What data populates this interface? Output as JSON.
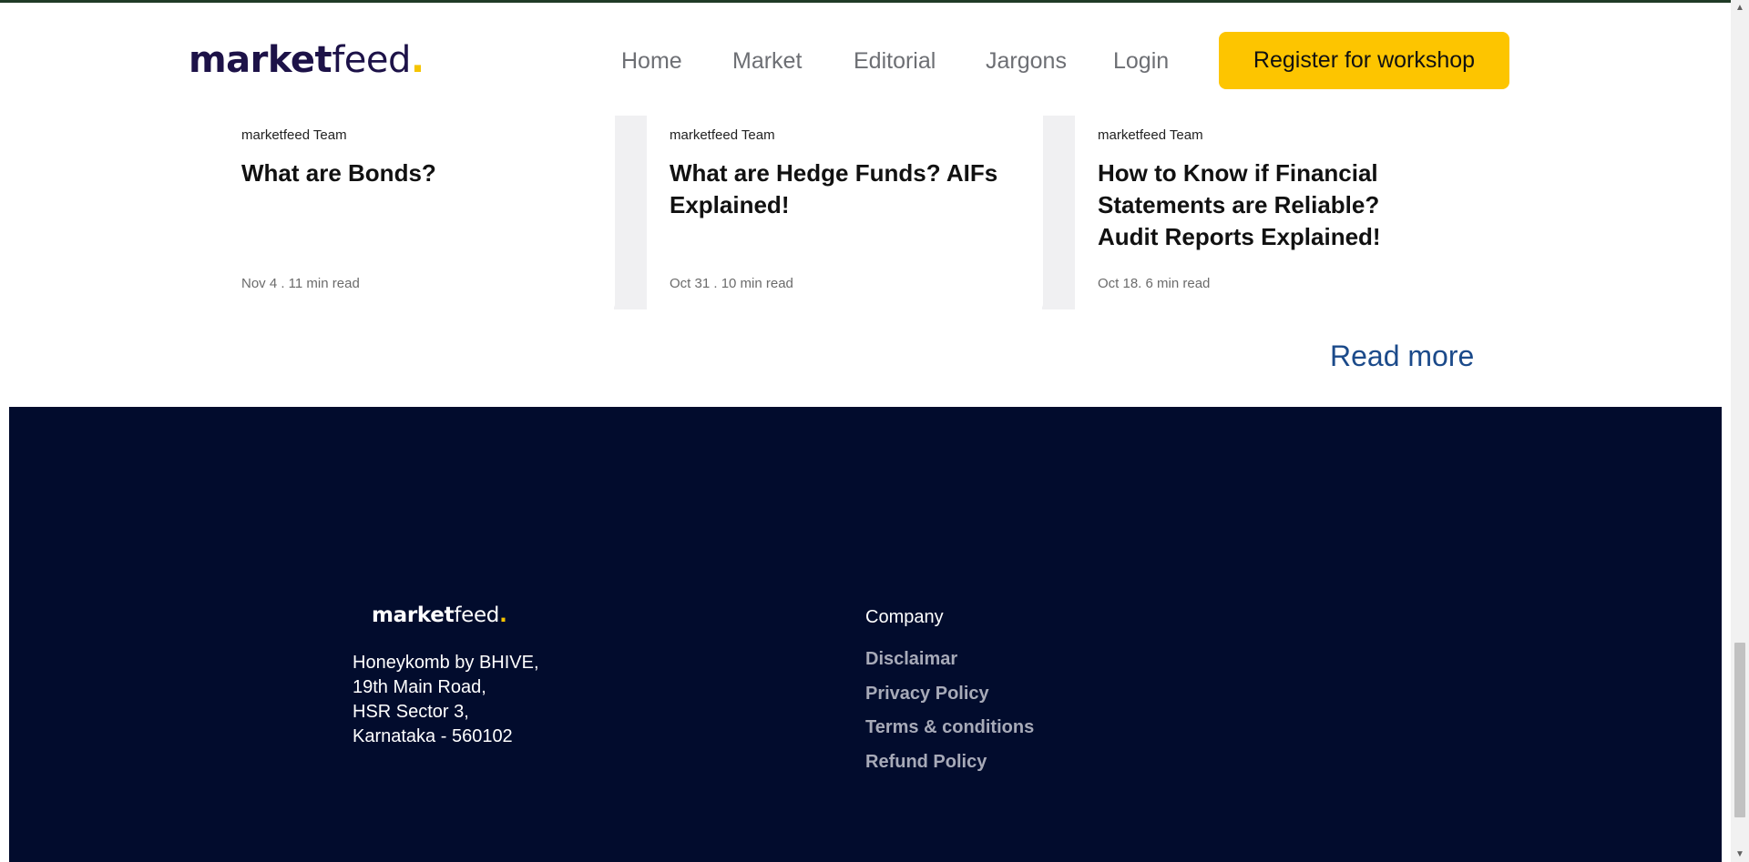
{
  "header": {
    "logo": {
      "part1": "market",
      "part2": "feed",
      "dot": "."
    },
    "nav": [
      "Home",
      "Market",
      "Editorial",
      "Jargons",
      "Login"
    ],
    "cta_label": "Register for workshop"
  },
  "articles": [
    {
      "author": "marketfeed Team",
      "title": "What are Bonds?",
      "meta": "Nov 4 . 11 min read"
    },
    {
      "author": "marketfeed Team",
      "title": "What are Hedge Funds? AIFs Explained!",
      "meta": "Oct 31 . 10 min read"
    },
    {
      "author": "marketfeed Team",
      "title": "How to Know if Financial Statements are Reliable? Audit Reports Explained!",
      "meta": "Oct 18. 6 min read"
    }
  ],
  "read_more": "Read more",
  "footer": {
    "logo": {
      "part1": "market",
      "part2": "feed",
      "dot": "."
    },
    "address": [
      "Honeykomb by BHIVE,",
      "19th Main Road,",
      "HSR Sector 3,",
      "Karnataka - 560102"
    ],
    "company_heading": "Company",
    "links": [
      "Disclaimar",
      "Privacy Policy",
      "Terms & conditions",
      "Refund Policy"
    ]
  },
  "colors": {
    "brand_dark": "#1d1248",
    "accent_yellow": "#fdc500",
    "footer_bg": "#020c2d",
    "link_blue": "#1b4a8a"
  }
}
